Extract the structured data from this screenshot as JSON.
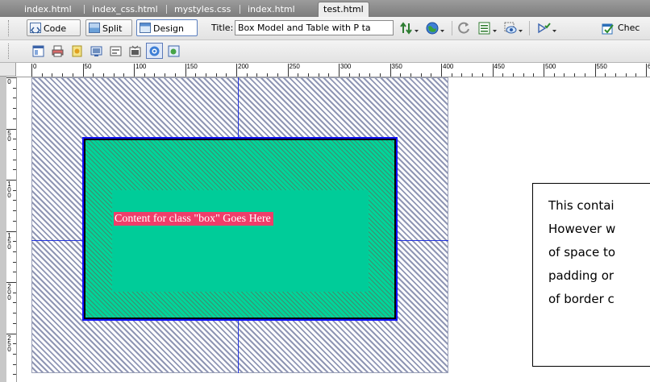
{
  "tabs": [
    {
      "label": "index.html",
      "active": false
    },
    {
      "label": "index_css.html",
      "active": false
    },
    {
      "label": "mystyles.css",
      "active": false
    },
    {
      "label": "index.html",
      "active": false
    },
    {
      "label": "test.html",
      "active": true
    }
  ],
  "toolbar": {
    "code_label": "Code",
    "split_label": "Split",
    "design_label": "Design",
    "active_view": "Design",
    "title_label": "Title:",
    "title_value": "Box Model and Table with P ta",
    "check_label": "Chec",
    "icons": [
      "file-management-icon",
      "preview-browser-icon",
      "refresh-icon",
      "view-options-icon",
      "visual-aids-icon",
      "validate-icon",
      "check-page-icon"
    ]
  },
  "insert_toolbar": {
    "icons": [
      "layout-icon",
      "print-icon",
      "text-icon",
      "image-icon",
      "form-icon",
      "media-icon",
      "browser-icon",
      "script-icon"
    ],
    "pressed_index": 6
  },
  "ruler": {
    "top_labels": [
      "0",
      "50",
      "100",
      "150",
      "200",
      "250",
      "300",
      "350",
      "400",
      "450",
      "500",
      "550",
      "600"
    ],
    "left_labels": [
      "0",
      "50",
      "100",
      "150",
      "200",
      "250"
    ]
  },
  "canvas": {
    "content_text": "Content for class \"box\" Goes Here",
    "note_lines": [
      "This contai",
      "However w",
      "of space to",
      "padding or",
      "of border c"
    ],
    "colors": {
      "hatch": "#8f96b4",
      "guide": "#2233dd",
      "box_border_outline": "#1010ff",
      "box_padding": "#00cc99",
      "content_highlight": "#ef3d6a"
    }
  }
}
